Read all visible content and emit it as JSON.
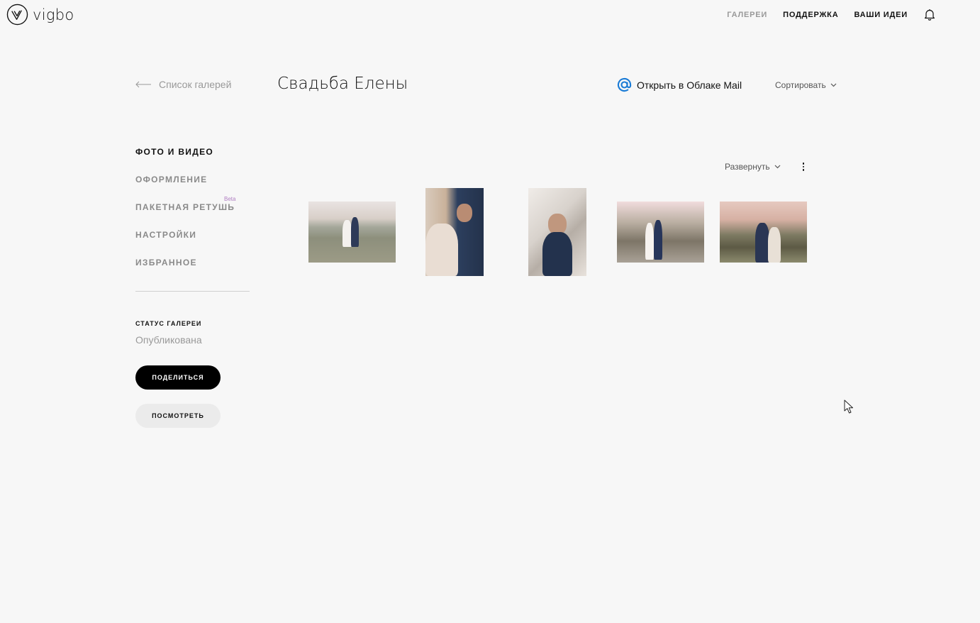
{
  "brand": {
    "name": "vigbo"
  },
  "topnav": {
    "items": [
      "ГАЛЕРЕИ",
      "ПОДДЕРЖКА",
      "ВАШИ ИДЕИ"
    ]
  },
  "header": {
    "back_label": "Список галерей",
    "title": "Свадьба Елены",
    "cloud_label": "Открыть в Облаке Mail",
    "sort_label": "Сортировать"
  },
  "sidebar": {
    "items": [
      {
        "label": "ФОТО И ВИДЕО"
      },
      {
        "label": "ОФОРМЛЕНИЕ"
      },
      {
        "label": "ПАКЕТНАЯ РЕТУШЬ",
        "badge": "Beta"
      },
      {
        "label": "НАСТРОЙКИ"
      },
      {
        "label": "ИЗБРАННОЕ"
      }
    ],
    "status_label": "СТАТУС ГАЛЕРЕИ",
    "status_value": "Опубликована",
    "share_label": "ПОДЕЛИТЬСЯ",
    "view_label": "ПОСМОТРЕТЬ"
  },
  "gallery": {
    "expand_label": "Развернуть"
  },
  "colors": {
    "accent": "#1a7bd6",
    "active": "#111111",
    "muted": "#8a8a8a",
    "beta": "#b07fc2"
  }
}
